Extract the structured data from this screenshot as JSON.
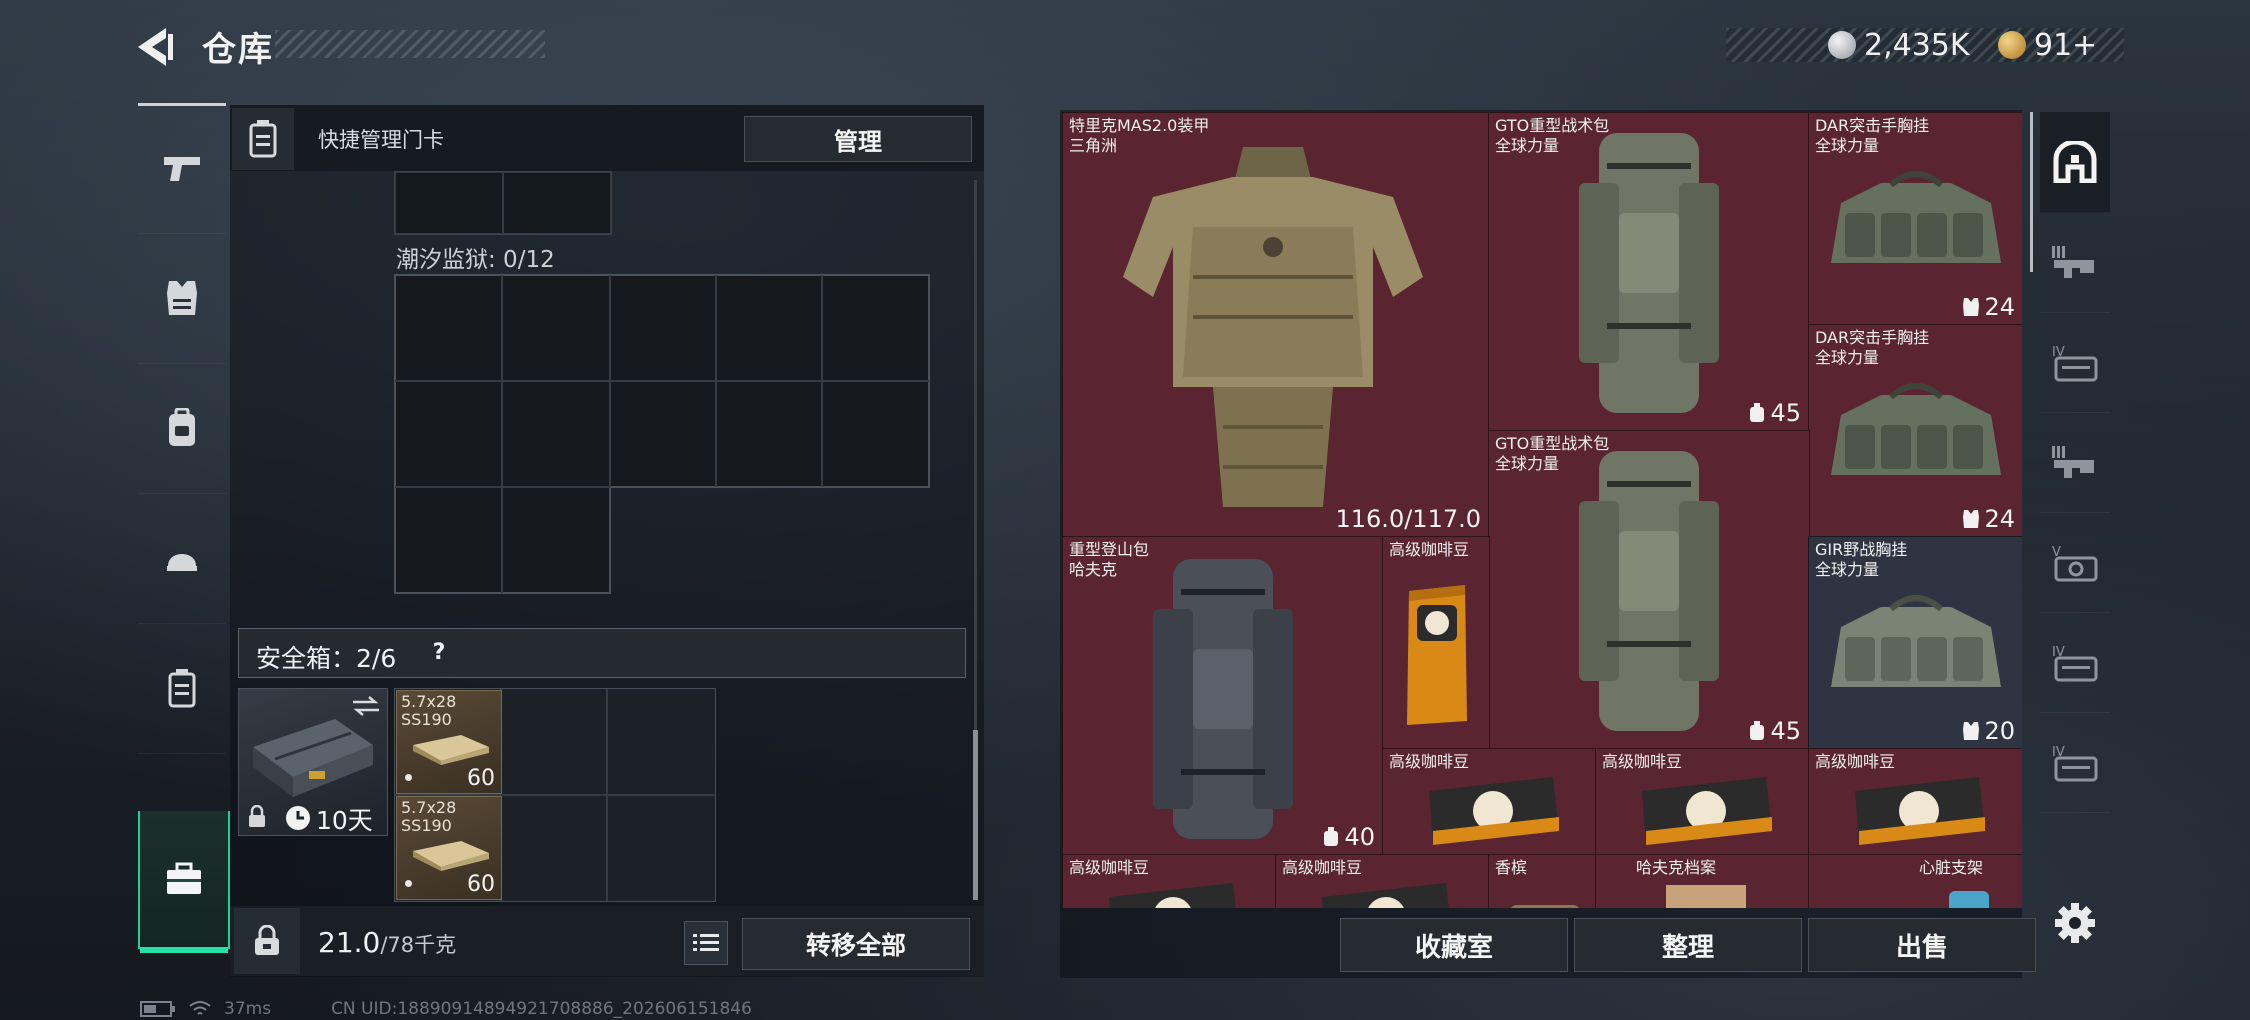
{
  "header": {
    "title": "仓库",
    "back_icon": "back-arrow-icon"
  },
  "currency": [
    {
      "icon": "silver-coin-icon",
      "value": "2,435K",
      "color": "#c9ced4"
    },
    {
      "icon": "gold-triangle-coin-icon",
      "value": "91+",
      "color": "#d6a748"
    }
  ],
  "left_rail": {
    "items": [
      {
        "icon": "pistol-icon",
        "name": "weapons"
      },
      {
        "icon": "armor-vest-icon",
        "name": "armor"
      },
      {
        "icon": "backpack-icon",
        "name": "backpack"
      },
      {
        "icon": "helmet-icon",
        "name": "helmet"
      },
      {
        "icon": "card-case-icon",
        "name": "keycard"
      },
      {
        "icon": "safe-box-icon",
        "name": "safebox",
        "active": true
      }
    ],
    "accent": "#27e0a8"
  },
  "keycard": {
    "label": "快捷管理门卡",
    "manage_label": "管理",
    "prison_label": "潮汐监狱: 0/12"
  },
  "safebox": {
    "label": "安全箱：2/6",
    "help": "?",
    "days": "10天",
    "items": [
      {
        "name": "5.7x28\nSS190",
        "count": "60"
      },
      {
        "name": "5.7x28\nSS190",
        "count": "60"
      }
    ]
  },
  "bottom_left": {
    "weight": "21.0",
    "weight_max": "/78千克",
    "transfer_label": "转移全部"
  },
  "stash": {
    "items": [
      {
        "name": "特里克MAS2.0装甲\n三角洲",
        "value": "116.0/117.0",
        "pic": "armor"
      },
      {
        "name": "GTO重型战术包\n全球力量",
        "value": "45",
        "pic": "bag"
      },
      {
        "name": "DAR突击手胸挂\n全球力量",
        "value": "24",
        "pic": "rig"
      },
      {
        "name": "DAR突击手胸挂\n全球力量",
        "value": "24",
        "pic": "rig"
      },
      {
        "name": "GTO重型战术包\n全球力量",
        "value": "45",
        "pic": "bag"
      },
      {
        "name": "重型登山包\n哈夫克",
        "value": "40",
        "pic": "bag2"
      },
      {
        "name": "高级咖啡豆",
        "value": "",
        "pic": "coffee"
      },
      {
        "name": "GIR野战胸挂\n全球力量",
        "value": "20",
        "pic": "rig"
      },
      {
        "name": "高级咖啡豆",
        "value": "",
        "pic": "coffee2"
      },
      {
        "name": "高级咖啡豆",
        "value": "",
        "pic": "coffee2"
      },
      {
        "name": "高级咖啡豆",
        "value": "",
        "pic": "coffee2"
      },
      {
        "name": "高级咖啡豆",
        "value": "",
        "pic": "coffee2"
      },
      {
        "name": "高级咖啡豆",
        "value": "",
        "pic": "coffee2"
      },
      {
        "name": "香槟",
        "value": "",
        "pic": "misc"
      },
      {
        "name": "哈夫克档案",
        "value": "",
        "pic": "misc"
      },
      {
        "name": "心脏支架",
        "value": "",
        "pic": "misc"
      }
    ],
    "item_color": "#5a2530"
  },
  "bottom_right": {
    "collection_label": "收藏室",
    "sort_label": "整理",
    "sell_label": "出售"
  },
  "right_rail": {
    "items": [
      {
        "icon": "all-items-icon"
      },
      {
        "icon": "rifle-tier-icon"
      },
      {
        "icon": "tier-iv-case-icon"
      },
      {
        "icon": "rifle-tier-icon"
      },
      {
        "icon": "tier-v-case-icon"
      },
      {
        "icon": "tier-iv-case-icon"
      },
      {
        "icon": "tier-iv-case-icon"
      }
    ],
    "settings_icon": "gear-icon"
  },
  "status": {
    "ping": "37ms",
    "uid": "CN UID:18890914894921708886_202606151846"
  }
}
